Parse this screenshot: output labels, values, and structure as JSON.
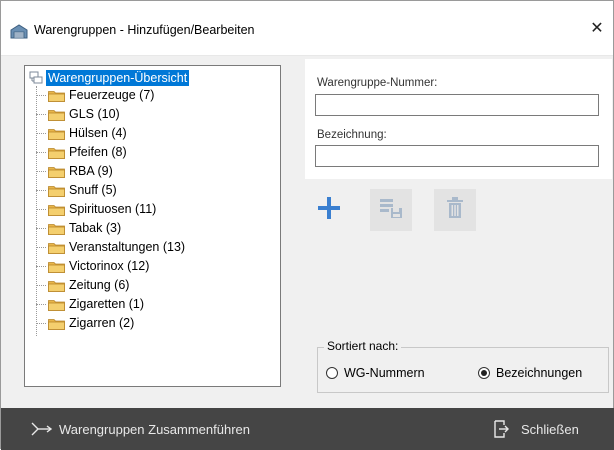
{
  "window": {
    "title": "Warengruppen - Hinzufügen/Bearbeiten",
    "icon": "warehouse-icon",
    "close_icon": "close-icon"
  },
  "tree": {
    "root_label": "Warengruppen-Übersicht",
    "items": [
      {
        "label": "Feuerzeuge (7)"
      },
      {
        "label": "GLS (10)"
      },
      {
        "label": "Hülsen (4)"
      },
      {
        "label": "Pfeifen (8)"
      },
      {
        "label": "RBA (9)"
      },
      {
        "label": "Snuff (5)"
      },
      {
        "label": "Spirituosen (11)"
      },
      {
        "label": "Tabak (3)"
      },
      {
        "label": "Veranstaltungen (13)"
      },
      {
        "label": "Victorinox (12)"
      },
      {
        "label": "Zeitung (6)"
      },
      {
        "label": "Zigaretten (1)"
      },
      {
        "label": "Zigarren (2)"
      }
    ]
  },
  "form": {
    "number_label": "Warengruppe-Nummer:",
    "number_value": "",
    "name_label": "Bezeichnung:",
    "name_value": ""
  },
  "toolbar": {
    "add_icon": "plus-icon",
    "save_icon": "save-list-icon",
    "delete_icon": "trash-icon"
  },
  "sort": {
    "legend": "Sortiert nach:",
    "options": [
      {
        "label": "WG-Nummern",
        "checked": false
      },
      {
        "label": "Bezeichnungen",
        "checked": true
      }
    ]
  },
  "footer": {
    "merge_label": "Warengruppen Zusammenführen",
    "close_label": "Schließen"
  },
  "colors": {
    "selection": "#0078d7",
    "footer_bg": "#454545",
    "accent_button": "#3a7fd0",
    "folder": "#e8b64a"
  }
}
